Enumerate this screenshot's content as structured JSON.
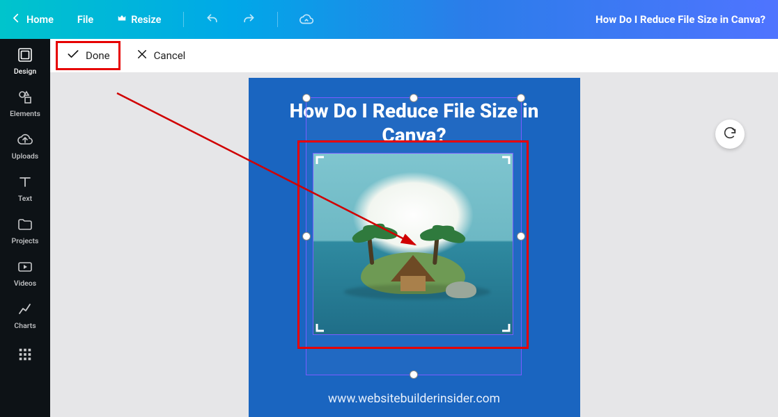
{
  "topbar": {
    "home": "Home",
    "file": "File",
    "resize": "Resize",
    "doc_title": "How Do I Reduce File Size in Canva?"
  },
  "actionbar": {
    "done": "Done",
    "cancel": "Cancel"
  },
  "rail": [
    {
      "id": "design",
      "label": "Design"
    },
    {
      "id": "elements",
      "label": "Elements"
    },
    {
      "id": "uploads",
      "label": "Uploads"
    },
    {
      "id": "text",
      "label": "Text"
    },
    {
      "id": "projects",
      "label": "Projects"
    },
    {
      "id": "videos",
      "label": "Videos"
    },
    {
      "id": "charts",
      "label": "Charts"
    }
  ],
  "canvas": {
    "heading": "How Do I Reduce File Size in Canva?",
    "footer": "www.websitebuilderinsider.com"
  }
}
